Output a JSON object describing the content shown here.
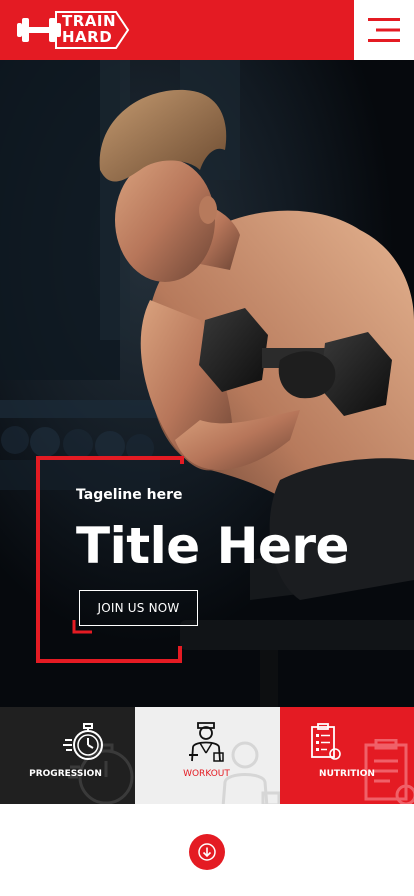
{
  "header": {
    "logo_line1": "TRAIN",
    "logo_line2": "HARD"
  },
  "hero": {
    "tagline": "Tageline here",
    "title": "Title Here",
    "cta_label": "JOIN US NOW"
  },
  "tiles": [
    {
      "label": "PROGRESSION",
      "icon": "stopwatch-icon"
    },
    {
      "label": "WORKOUT",
      "icon": "trainer-icon"
    },
    {
      "label": "NUTRITION",
      "icon": "clipboard-icon"
    }
  ],
  "colors": {
    "brand_red": "#e41b23",
    "dark": "#202020",
    "light": "#efefef"
  },
  "scroll_icon": "arrow-down-icon"
}
